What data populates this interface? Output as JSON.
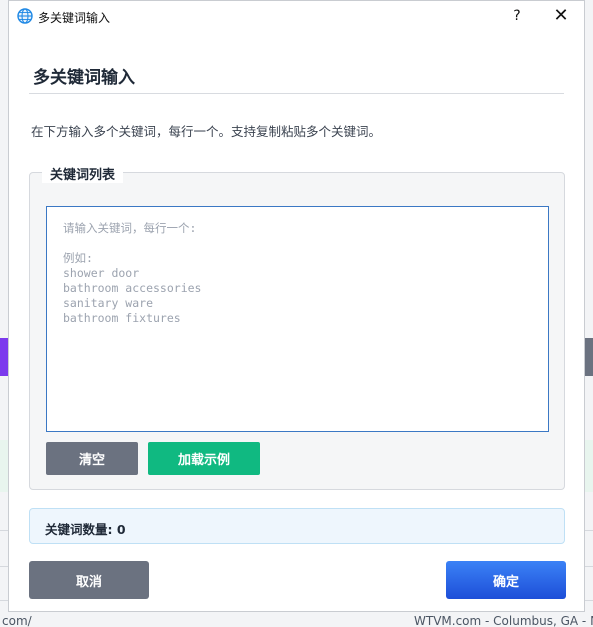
{
  "window": {
    "title": "多关键词输入",
    "help_label": "?",
    "close_label": "✕"
  },
  "dialog": {
    "heading": "多关键词输入",
    "description": "在下方输入多个关键词，每行一个。支持复制粘贴多个关键词。",
    "fieldset_legend": "关键词列表",
    "textarea_placeholder": "请输入关键词，每行一个:\n\n例如:\nshower door\nbathroom accessories\nsanitary ware\nbathroom fixtures",
    "clear_label": "清空",
    "load_example_label": "加载示例",
    "count_label": "关键词数量: 0",
    "cancel_label": "取消",
    "ok_label": "确定"
  },
  "background": {
    "bottom_left_text": "com/",
    "bottom_right_text": "WTVM.com - Columbus, GA - New"
  },
  "colors": {
    "clear_button": "#6b7280",
    "example_button": "#10b981",
    "ok_button": "#2563eb",
    "textarea_border": "#3b78c4",
    "count_box_bg": "#eef6fd"
  }
}
